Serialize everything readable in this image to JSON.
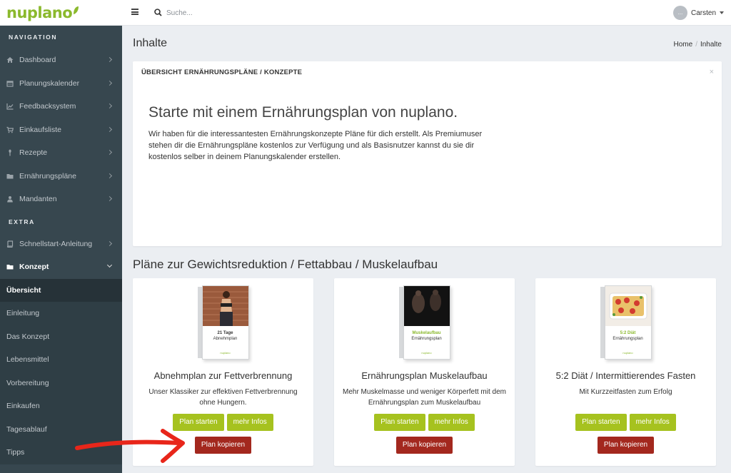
{
  "brand": {
    "logo_text": "nuplano",
    "accent": "#8bb92d"
  },
  "topbar": {
    "search_placeholder": "Suche...",
    "user_name": "Carsten",
    "avatar_text": "..."
  },
  "sidebar": {
    "sections": {
      "navigation": "NAVIGATION",
      "extra": "EXTRA"
    },
    "nav_items": [
      {
        "label": "Dashboard",
        "icon": "home-icon"
      },
      {
        "label": "Planungskalender",
        "icon": "calendar-icon"
      },
      {
        "label": "Feedbacksystem",
        "icon": "chart-icon"
      },
      {
        "label": "Einkaufsliste",
        "icon": "cart-icon"
      },
      {
        "label": "Rezepte",
        "icon": "spoon-icon"
      },
      {
        "label": "Ernährungspläne",
        "icon": "folder-icon"
      },
      {
        "label": "Mandanten",
        "icon": "user-icon"
      }
    ],
    "extra_items": [
      {
        "label": "Schnellstart-Anleitung",
        "icon": "book-icon"
      },
      {
        "label": "Konzept",
        "icon": "folder-open-icon",
        "expanded": true
      }
    ],
    "sub_items": [
      "Übersicht",
      "Einleitung",
      "Das Konzept",
      "Lebensmittel",
      "Vorbereitung",
      "Einkaufen",
      "Tagesablauf",
      "Tipps"
    ],
    "active_sub": "Übersicht"
  },
  "page": {
    "title": "Inhalte",
    "breadcrumb": {
      "home": "Home",
      "current": "Inhalte"
    }
  },
  "intro": {
    "header": "ÜBERSICHT ERNÄHRUNGSPLÄNE / KONZEPTE",
    "close": "×",
    "title": "Starte mit einem Ernährungsplan von nuplano.",
    "text": "Wir haben für die interessantesten Ernährungskonzepte Pläne für dich erstellt. Als Premiumuser stehen dir die Ernährungspläne kostenlos zur Verfügung und als Basisnutzer kannst du sie dir kostenlos selber in deinem Planungskalender erstellen."
  },
  "plans_section": {
    "title": "Pläne zur Gewichtsreduktion / Fettabbau / Muskelaufbau"
  },
  "plans": [
    {
      "name": "Abnehmplan zur Fettverbrennung",
      "description": "Unser Klassiker zur effektiven Fettverbrennung ohne Hungern.",
      "cover_title": "21 Tage",
      "cover_subtitle": "Abnehmplan",
      "cover_brand": "nuplano"
    },
    {
      "name": "Ernährungsplan Muskelaufbau",
      "description": "Mehr Muskelmasse und weniger Körperfett mit dem Ernährungsplan zum Muskelaufbau",
      "cover_title": "Muskelaufbau",
      "cover_subtitle": "Ernährungsplan",
      "cover_brand": "nuplano"
    },
    {
      "name": "5:2 Diät / Intermittierendes Fasten",
      "description": "Mit Kurzzeitfasten zum Erfolg",
      "cover_title": "5:2 Diät",
      "cover_subtitle": "Ernährungsplan",
      "cover_brand": "nuplano"
    }
  ],
  "buttons": {
    "start": "Plan starten",
    "info": "mehr Infos",
    "copy": "Plan kopieren"
  },
  "colors": {
    "sidebar": "#37474f",
    "green_button": "#a6c21f",
    "red_button": "#a3281e",
    "arrow": "#e8261a"
  }
}
